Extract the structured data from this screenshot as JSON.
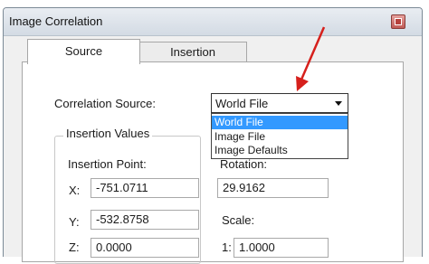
{
  "window": {
    "title": "Image Correlation"
  },
  "tabs": [
    {
      "label": "Source"
    },
    {
      "label": "Insertion"
    }
  ],
  "correlation_source": {
    "label": "Correlation Source:",
    "selected": "World File",
    "options": [
      "World File",
      "Image File",
      "Image Defaults"
    ]
  },
  "insertion_values": {
    "group_label": "Insertion Values",
    "point_label": "Insertion Point:",
    "x_label": "X:",
    "x_value": "-751.0711",
    "y_label": "Y:",
    "y_value": "-532.8758",
    "z_label": "Z:",
    "z_value": "0.0000"
  },
  "rotation": {
    "label": "Rotation:",
    "value": "29.9162"
  },
  "scale": {
    "label": "Scale:",
    "prefix": "1:",
    "value": "1.0000"
  },
  "colors": {
    "selection": "#3399ff",
    "annotation_arrow": "#d6201c"
  }
}
